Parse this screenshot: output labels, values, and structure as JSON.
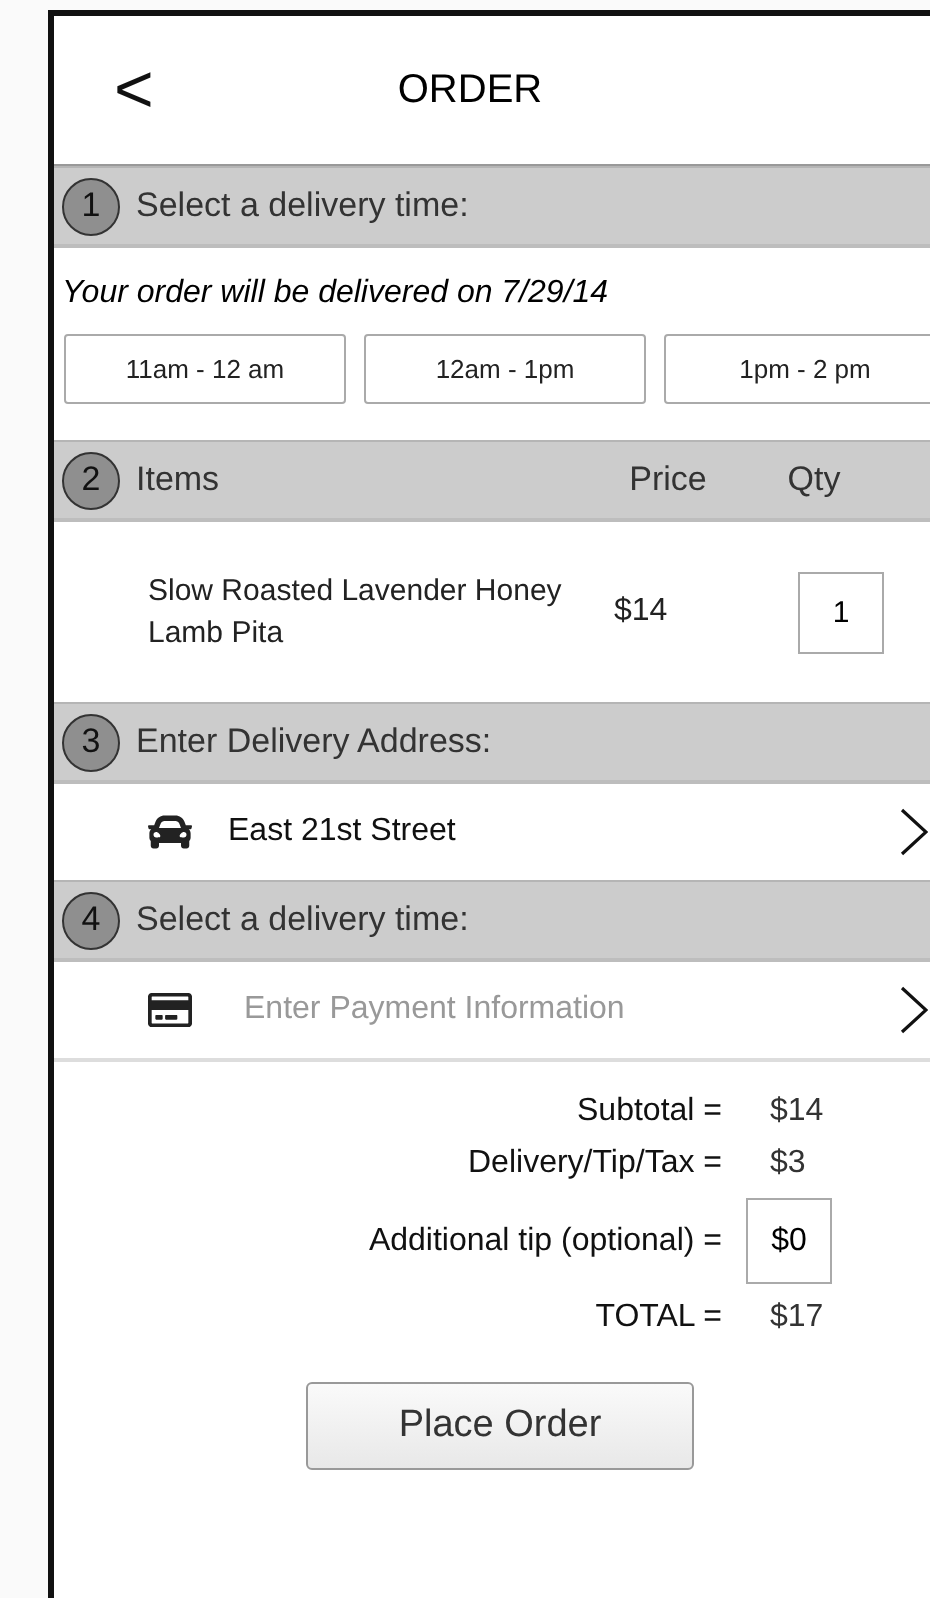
{
  "header": {
    "back_icon": "<",
    "title": "ORDER"
  },
  "sections": [
    {
      "kind": "delivery",
      "number": "1",
      "title": "Select a delivery time:",
      "note": "Your order will be delivered on 7/29/14",
      "slots": [
        {
          "label": "11am - 12 am",
          "selected": false
        },
        {
          "label": "12am - 1pm",
          "selected": false
        },
        {
          "label": "1pm - 2 pm",
          "selected": false
        }
      ]
    },
    {
      "kind": "items",
      "number": "2",
      "title": "Items",
      "columns": [
        "Price",
        "Qty"
      ],
      "rows": [
        {
          "name": "Slow Roasted Lavender Honey Lamb Pita",
          "price": "$14",
          "qty": "1"
        }
      ]
    },
    {
      "kind": "address",
      "number": "3",
      "title": "Enter Delivery Address:",
      "value": "East 21st Street"
    },
    {
      "kind": "payment",
      "number": "4",
      "title": "Select a delivery time:",
      "placeholder": "Enter Payment Information"
    }
  ],
  "totals": [
    {
      "label": "Subtotal =",
      "value": "$14",
      "kind": "text"
    },
    {
      "label": "Delivery/Tip/Tax =",
      "value": "$3",
      "kind": "text"
    },
    {
      "label": "Additional tip (optional) =",
      "value": "$0",
      "kind": "input"
    },
    {
      "label": "TOTAL =",
      "value": "$17",
      "kind": "text"
    }
  ],
  "button": "Place Order"
}
